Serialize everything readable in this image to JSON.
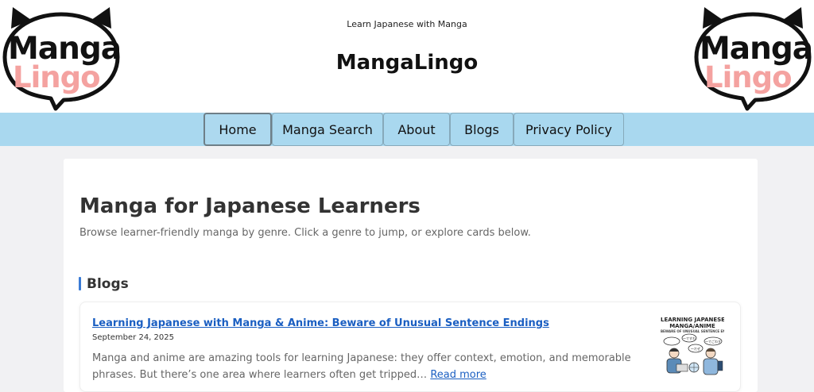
{
  "header": {
    "tagline": "Learn Japanese with Manga",
    "site_title": "MangaLingo",
    "logo": {
      "word1": "Manga",
      "word2": "Lingo"
    }
  },
  "nav": {
    "items": [
      {
        "label": "Home"
      },
      {
        "label": "Manga Search"
      },
      {
        "label": "About"
      },
      {
        "label": "Blogs"
      },
      {
        "label": "Privacy Policy"
      }
    ]
  },
  "main": {
    "title": "Manga for Japanese Learners",
    "subtitle": "Browse learner-friendly manga by genre. Click a genre to jump, or explore cards below.",
    "section_heading": "Blogs",
    "posts": [
      {
        "title": "Learning Japanese with Manga & Anime: Beware of Unusual Sentence Endings",
        "date": "September 24, 2025",
        "excerpt": "Manga and anime are amazing tools for learning Japanese: they offer context, emotion, and memorable phrases. But there’s one area where learners often get tripped…",
        "read_more": "Read more",
        "thumb": {
          "line1": "LEARNING JAPANESE WITH",
          "line2": "MANGA/ANIME",
          "line3": "BEWARE OF UNUSUAL SENTENCE ENDINGS",
          "bubble1": "〜ですわ",
          "bubble2": "〜だぜ",
          "bubble3": "〜でごわす"
        }
      }
    ]
  },
  "colors": {
    "nav_background": "#a9d8ef",
    "link": "#1b5fc2",
    "accent_bar": "#3a7bd5",
    "logo_black": "#111111",
    "logo_pink": "#f4a2a0",
    "page_background": "#f1f1f3"
  }
}
